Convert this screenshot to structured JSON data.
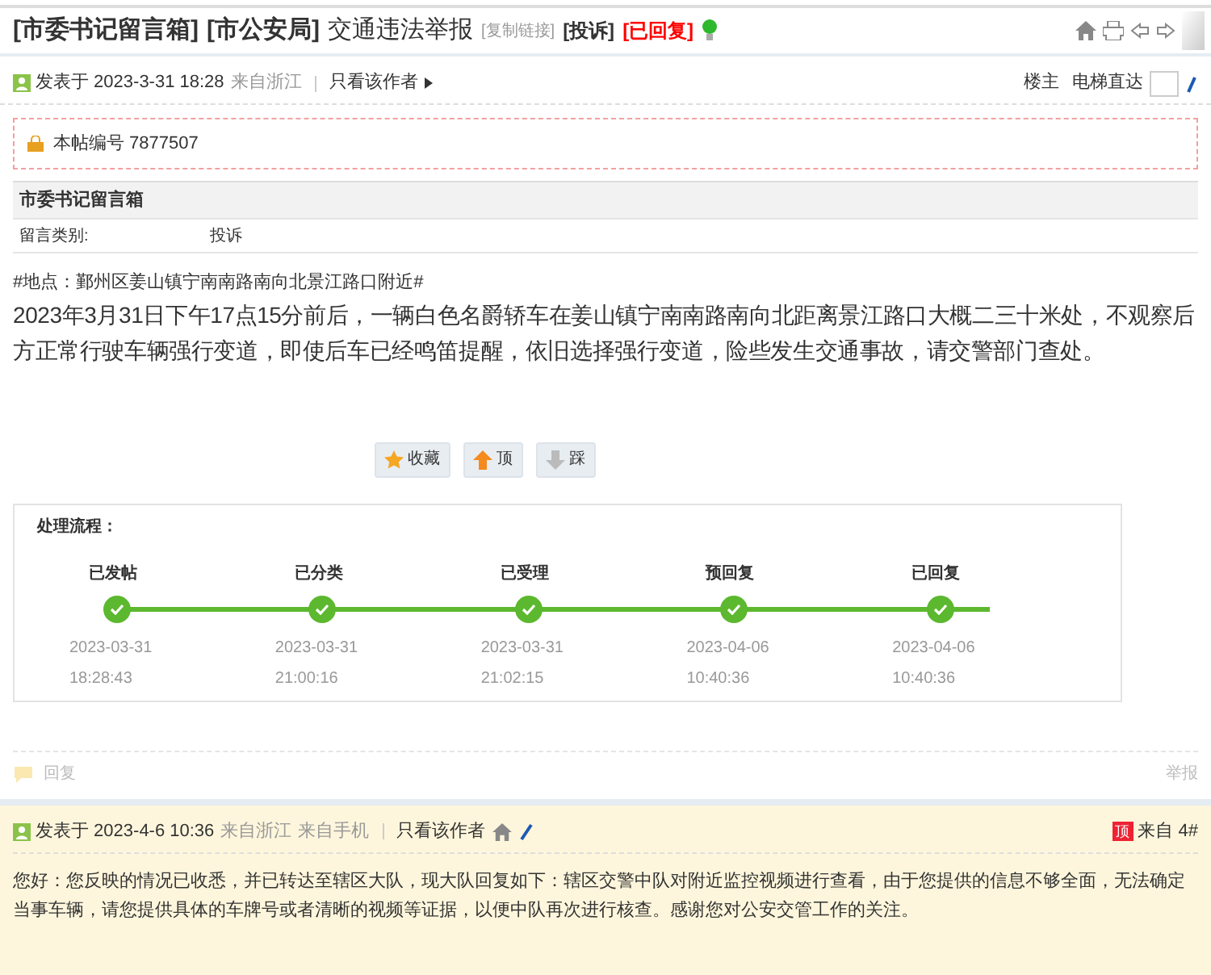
{
  "title": {
    "forum": "[市委书记留言箱]",
    "department": "[市公安局]",
    "subject": "交通违法举报",
    "copy_link": "[复制链接]",
    "category": "[投诉]",
    "status": "[已回复]"
  },
  "post": {
    "posted": "发表于 2023-3-31 18:28",
    "from": "来自浙江",
    "only_author": "只看该作者",
    "floor_label": "楼主",
    "jump_label": "电梯直达",
    "post_number": "本帖编号 7877507",
    "info_title": "市委书记留言箱",
    "info_rows": [
      {
        "label": "留言类别:",
        "value": "投诉"
      }
    ],
    "location": "#地点：鄞州区姜山镇宁南南路南向北景江路口附近#",
    "body": "2023年3月31日下午17点15分前后，一辆白色名爵轿车在姜山镇宁南南路南向北距离景江路口大概二三十米处，不观察后方正常行驶车辆强行变道，即使后车已经鸣笛提醒，依旧选择强行变道，险些发生交通事故，请交警部门查处。",
    "actions": [
      {
        "kind": "favorite",
        "label": "收藏"
      },
      {
        "kind": "up",
        "label": "顶"
      },
      {
        "kind": "down",
        "label": "踩"
      }
    ]
  },
  "process": {
    "title": "处理流程：",
    "steps": [
      {
        "label": "已发帖",
        "done": true,
        "date": "2023-03-31",
        "time": "18:28:43"
      },
      {
        "label": "已分类",
        "done": true,
        "date": "2023-03-31",
        "time": "21:00:16"
      },
      {
        "label": "已受理",
        "done": true,
        "date": "2023-03-31",
        "time": "21:02:15"
      },
      {
        "label": "预回复",
        "done": true,
        "date": "2023-04-06",
        "time": "10:40:36"
      },
      {
        "label": "已回复",
        "done": true,
        "date": "2023-04-06",
        "time": "10:40:36"
      }
    ]
  },
  "reply_bar": {
    "reply": "回复",
    "report": "举报"
  },
  "reply": {
    "posted": "发表于 2023-4-6 10:36",
    "from": "来自浙江",
    "device": "来自手机",
    "only_author": "只看该作者",
    "badge": "顶",
    "floor": "来自 4#",
    "body": "您好：您反映的情况已收悉，并已转达至辖区大队，现大队回复如下：辖区交警中队对附近监控视频进行查看，由于您提供的信息不够全面，无法确定当事车辆，请您提供具体的车牌号或者清晰的视频等证据，以便中队再次进行核查。感谢您对公安交管工作的关注。"
  }
}
